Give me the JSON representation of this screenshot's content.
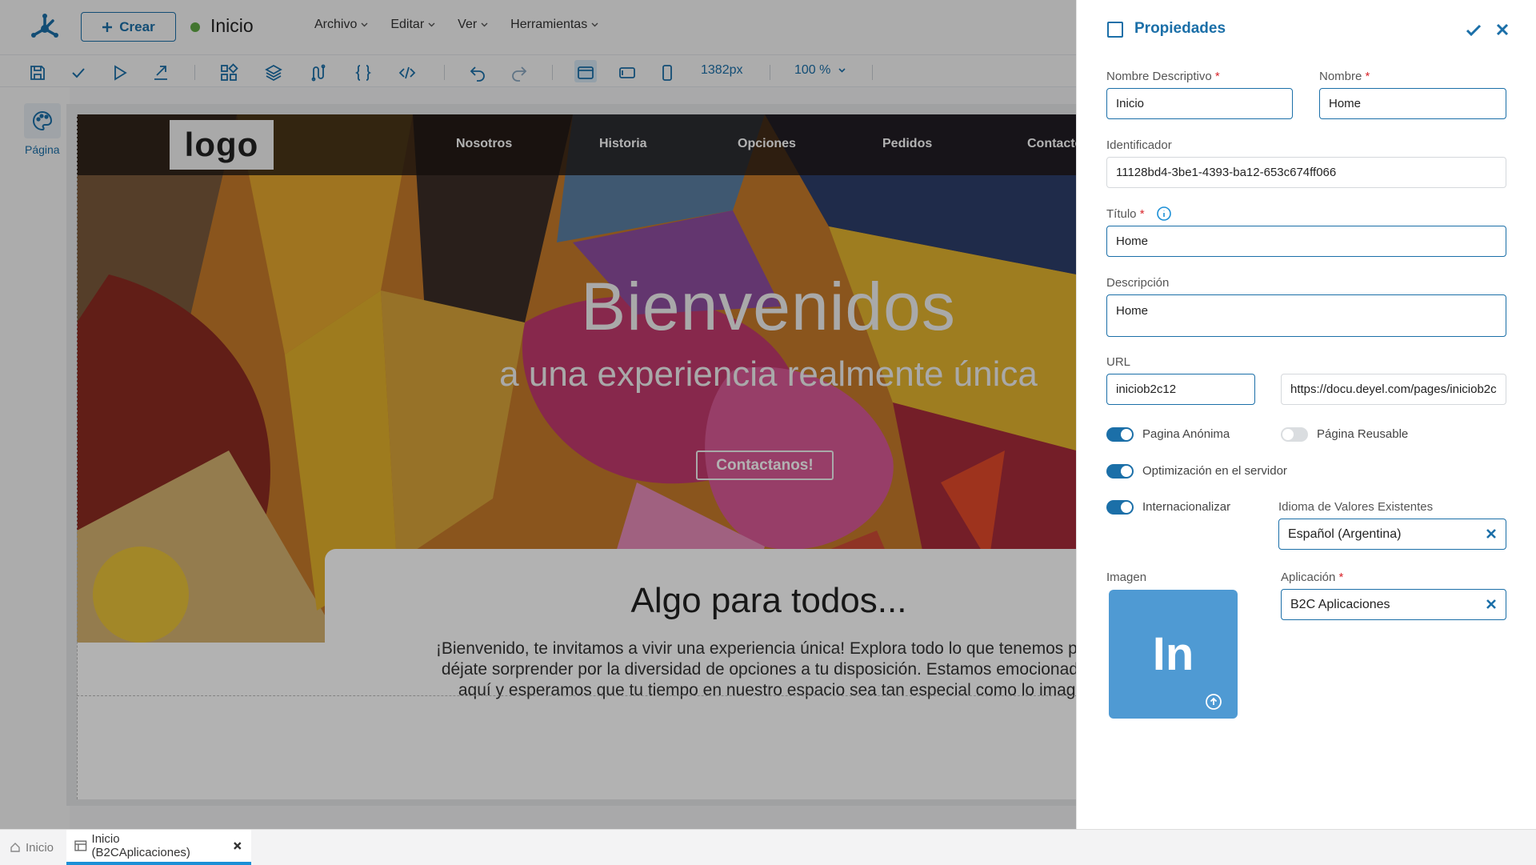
{
  "header": {
    "create_label": "Crear",
    "page_name": "Inicio",
    "menu": [
      {
        "label": "Archivo"
      },
      {
        "label": "Editar"
      },
      {
        "label": "Ver"
      },
      {
        "label": "Herramientas"
      }
    ]
  },
  "toolbar": {
    "width_value": "1382px",
    "zoom_value": "100 %"
  },
  "rail": {
    "page_label": "Página"
  },
  "canvas": {
    "logo_text": "logo",
    "nav": [
      "Nosotros",
      "Historia",
      "Opciones",
      "Pedidos",
      "Contacto"
    ],
    "hero_title": "Bienvenidos",
    "hero_subtitle": "a una experiencia realmente única",
    "hero_button": "Contactanos!",
    "card_title": "Algo para todos...",
    "card_lines": [
      "¡Bienvenido, te invitamos a vivir una experiencia única! Explora todo lo que tenemos para",
      "déjate sorprender por la diversidad de opciones a tu disposición. Estamos emocionados",
      "aquí y esperamos que tu tiempo en nuestro espacio sea tan especial como lo imagi"
    ]
  },
  "panel": {
    "title": "Propiedades",
    "nombre_descriptivo": {
      "label": "Nombre Descriptivo",
      "value": "Inicio"
    },
    "nombre": {
      "label": "Nombre",
      "value": "Home"
    },
    "identificador": {
      "label": "Identificador",
      "value": "11128bd4-3be1-4393-ba12-653c674ff066"
    },
    "titulo": {
      "label": "Título",
      "value": "Home"
    },
    "descripcion": {
      "label": "Descripción",
      "value": "Home"
    },
    "url": {
      "label": "URL",
      "value": "iniciob2c12",
      "full": "https://docu.deyel.com/pages/iniciob2c"
    },
    "toggles": {
      "anonima": {
        "label": "Pagina Anónima",
        "on": true
      },
      "reusable": {
        "label": "Página Reusable",
        "on": false
      },
      "optimizacion": {
        "label": "Optimización en el servidor",
        "on": true
      },
      "internacionalizar": {
        "label": "Internacionalizar",
        "on": true
      }
    },
    "idioma": {
      "label": "Idioma de Valores Existentes",
      "value": "Español (Argentina)"
    },
    "imagen": {
      "label": "Imagen",
      "initials": "In"
    },
    "aplicacion": {
      "label": "Aplicación",
      "value": "B2C Aplicaciones"
    }
  },
  "bottom_tabs": [
    {
      "label": "Inicio"
    },
    {
      "label": "Inicio (B2CAplicaciones)"
    }
  ],
  "colors": {
    "accent": "#1b6fa8",
    "status": "#5fa844",
    "required": "#d9262c"
  }
}
